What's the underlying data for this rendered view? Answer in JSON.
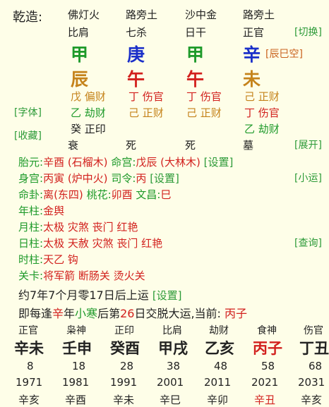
{
  "chart": {
    "label": "乾造:",
    "nayin": [
      "佛灯火",
      "路旁土",
      "沙中金",
      "路旁土"
    ],
    "ten_gods": [
      "比肩",
      "七杀",
      "日干",
      "正官"
    ],
    "stems": [
      "甲",
      "庚",
      "甲",
      "辛"
    ],
    "branches": [
      "辰",
      "午",
      "午",
      "未"
    ],
    "kongwang": "[辰巳空]",
    "hidden": [
      [
        "戊 偏财",
        "乙 劫财",
        "癸 正印"
      ],
      [
        "丁 伤官",
        "己 正财"
      ],
      [
        "丁 伤官",
        "己 正财"
      ],
      [
        "己 正财",
        "丁 伤官",
        "乙 劫财"
      ]
    ],
    "states": [
      "衰",
      "死",
      "死",
      "墓"
    ]
  },
  "actions": {
    "switch": "[切换]",
    "font": "[字体]",
    "collect": "[收藏]",
    "expand": "[展开]",
    "small_luck": "[小运]",
    "query": "[查询]"
  },
  "info": {
    "taiyuan_label": "胎元:",
    "taiyuan_value": "辛酉 (石榴木)",
    "minggong_label": "命宫:",
    "minggong_value": "戊辰 (大林木)",
    "shengong_label": "身宫:",
    "shengong_value": "丙寅 (炉中火)",
    "siling_label": "司令:",
    "siling_value": "丙",
    "setting": "[设置]",
    "minggua_label": "命卦:",
    "minggua_value": "离(东四)",
    "taohua_label": "桃花:",
    "taohua_value": "卯酉",
    "wenchang_label": "文昌:",
    "wenchang_value": "巳",
    "nianzhu_label": "年柱:",
    "nianzhu_value": "金舆",
    "yuezhu_label": "月柱:",
    "yuezhu_value": "太极 灾煞 丧门 红艳",
    "rizhu_label": "日柱:",
    "rizhu_value": "太极 天赦 灾煞 丧门 红艳",
    "shizhu_label": "时柱:",
    "shizhu_value": "天乙 钩",
    "guansha_label": "关卡:",
    "guansha_value": "将军箭 断肠关 烫火关"
  },
  "luck": {
    "start_text": "约7年7个月零17日后上运",
    "setting": "[设置]",
    "rule_1": "即每逢",
    "rule_stem": "辛",
    "rule_2": "年",
    "rule_term": "小寒",
    "rule_3": "后第",
    "rule_day": "26",
    "rule_4": "日交脱大运,当前:",
    "current": "丙子",
    "gods": [
      "正官",
      "枭神",
      "正印",
      "比肩",
      "劫财",
      "食神",
      "伤官"
    ],
    "pillars": [
      "辛未",
      "壬申",
      "癸酉",
      "甲戌",
      "乙亥",
      "丙子",
      "丁丑"
    ],
    "ages": [
      "8",
      "18",
      "28",
      "38",
      "48",
      "58",
      "68"
    ],
    "years": [
      "1971",
      "1981",
      "1991",
      "2001",
      "2011",
      "2021",
      "2031"
    ],
    "next": [
      "辛亥",
      "辛酉",
      "辛未",
      "辛巳",
      "辛卯",
      "辛丑",
      "辛亥"
    ]
  }
}
